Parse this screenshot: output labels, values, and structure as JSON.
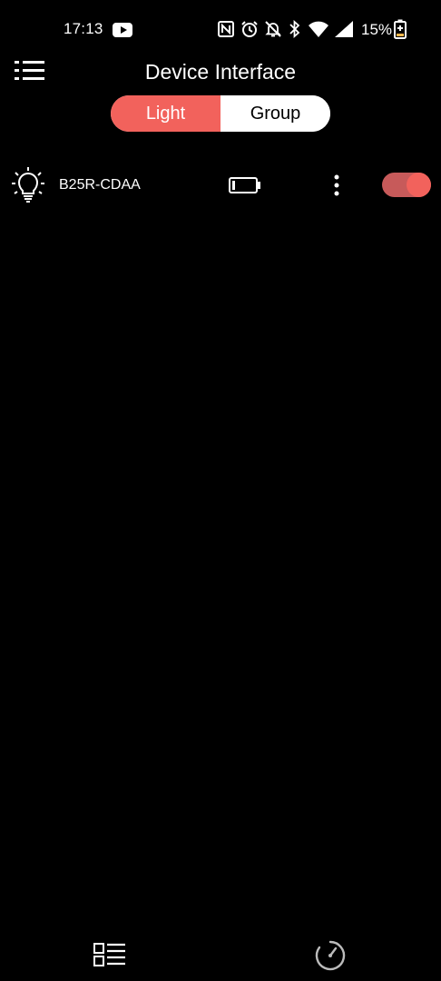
{
  "status_bar": {
    "time": "17:13",
    "battery_percent": "15%",
    "icons": [
      "youtube-icon",
      "nfc-icon",
      "alarm-icon",
      "notifications-off-icon",
      "bluetooth-icon",
      "wifi-icon",
      "signal-icon",
      "battery-charging-icon"
    ]
  },
  "header": {
    "title": "Device Interface",
    "menu_icon": "menu-list-icon"
  },
  "tabs": {
    "light_label": "Light",
    "group_label": "Group",
    "selected": "Light"
  },
  "devices": [
    {
      "name": "B25R-CDAA",
      "icon": "light-bulb-icon",
      "battery_icon": "battery-low-icon",
      "more_icon": "more-vertical-icon",
      "power_on": true
    }
  ],
  "bottom_nav": {
    "items": [
      "list-view-icon",
      "timer-icon"
    ]
  },
  "colors": {
    "accent": "#f2625c",
    "toggle_track": "#c75a5a",
    "background": "#000000",
    "text": "#ffffff"
  }
}
